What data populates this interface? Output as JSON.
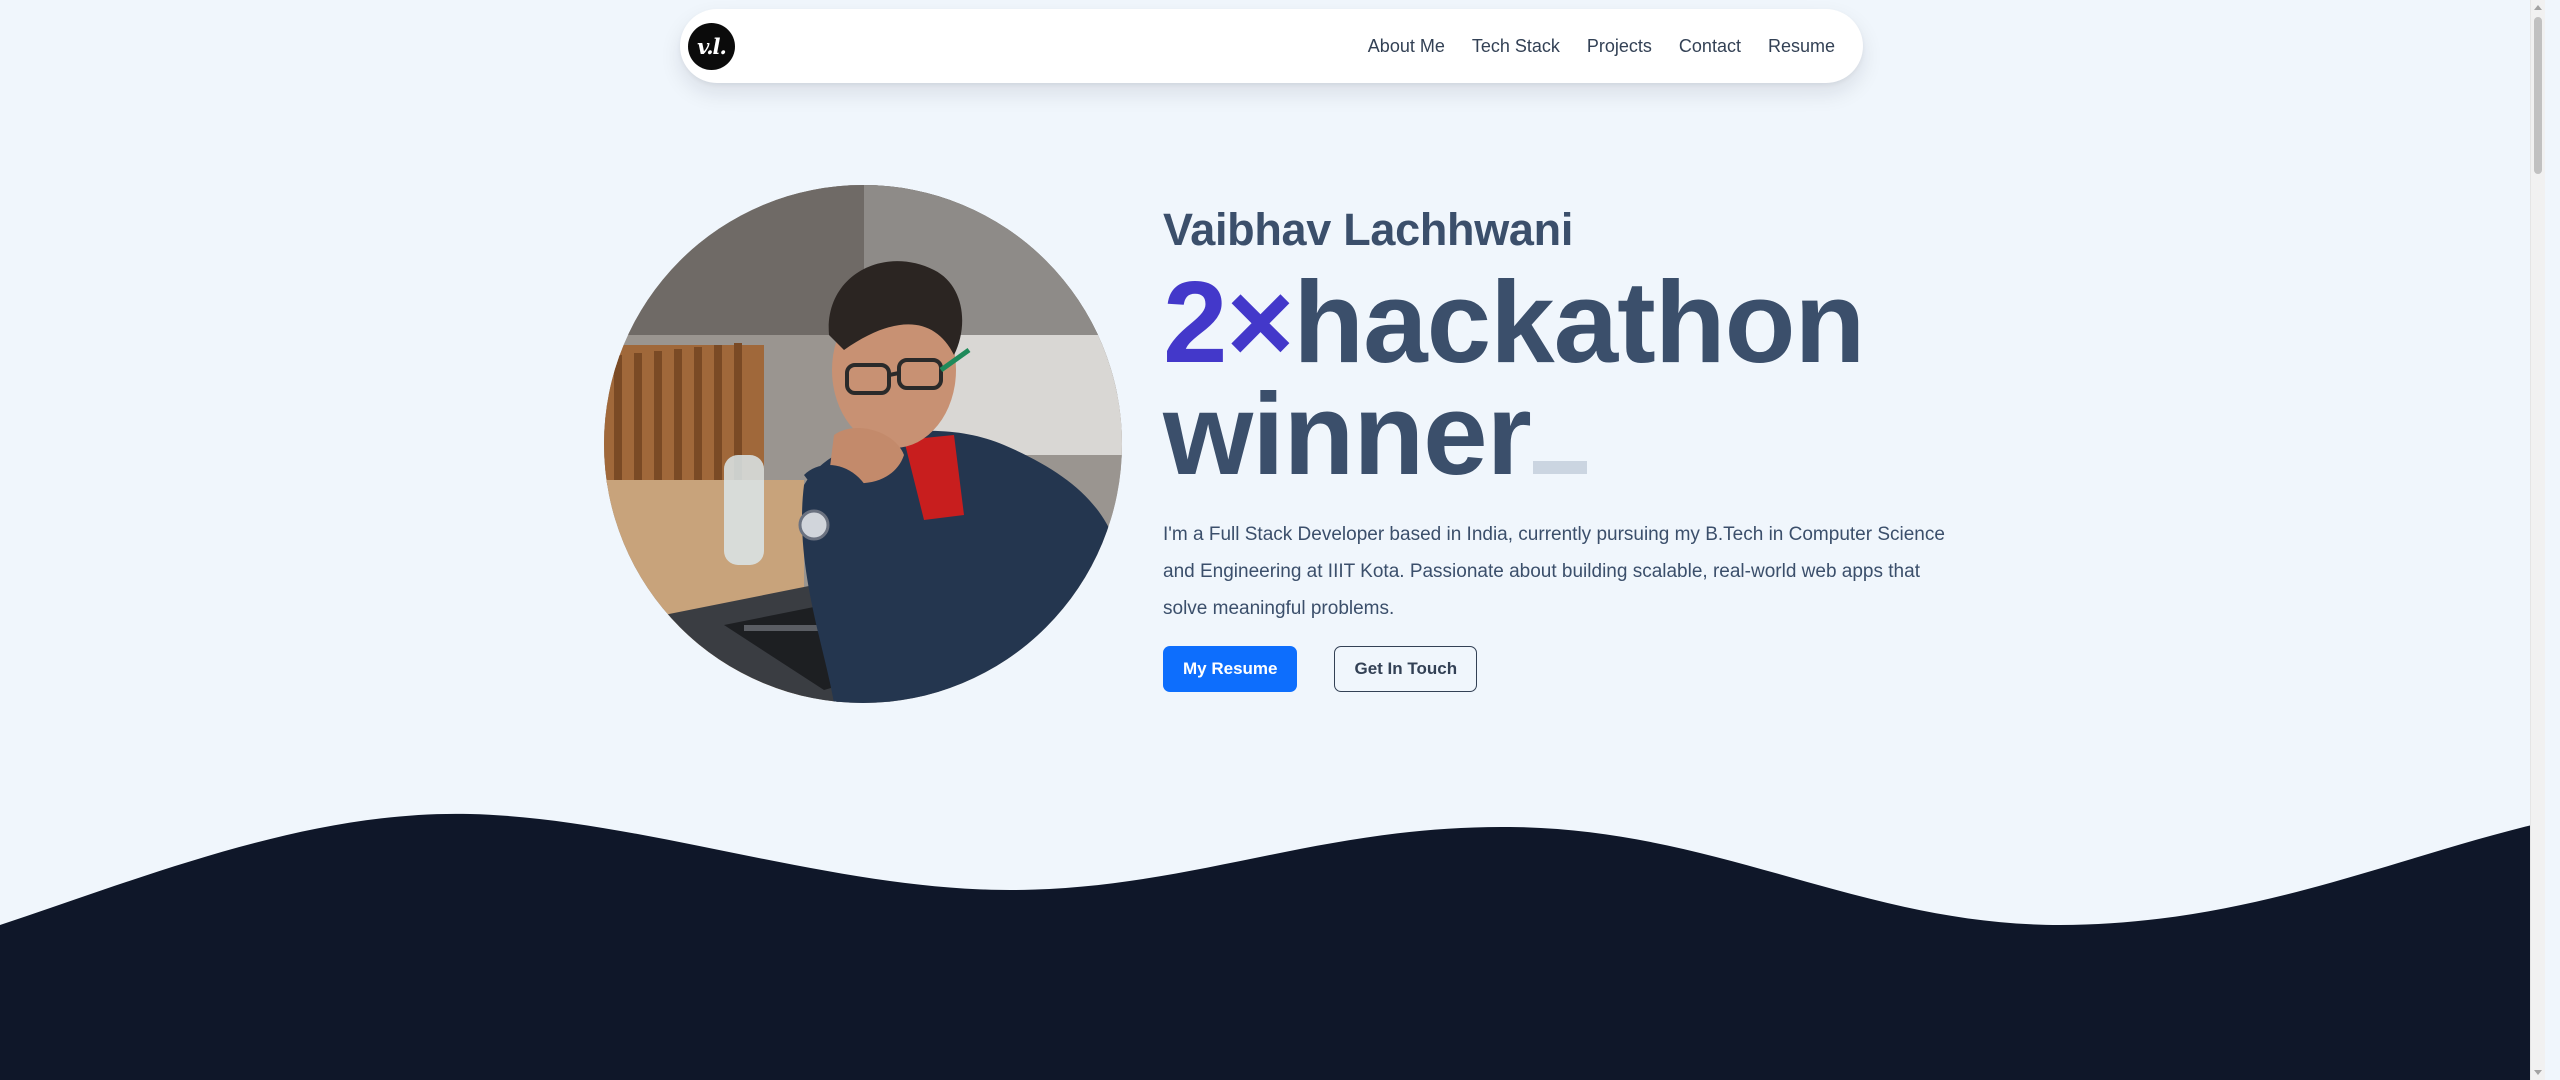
{
  "nav": {
    "logo_text": "v.l.",
    "links": [
      "About Me",
      "Tech Stack",
      "Projects",
      "Contact",
      "Resume"
    ]
  },
  "hero": {
    "name": "Vaibhav Lachhwani",
    "headline_accent": "2×",
    "headline_rest": "hackathon winner",
    "bio": "I'm a Full Stack Developer based in India, currently pursuing my B.Tech in Computer Science and Engineering at IIIT Kota. Passionate about building scalable, real-world web apps that solve meaningful problems.",
    "primary_button": "My Resume",
    "secondary_button": "Get In Touch"
  },
  "colors": {
    "page_background": "#f0f6fc",
    "accent_purple": "#4338ca",
    "heading_slate": "#3b4f6b",
    "primary_blue": "#0d6efd",
    "dark_wave": "#0f1729"
  }
}
